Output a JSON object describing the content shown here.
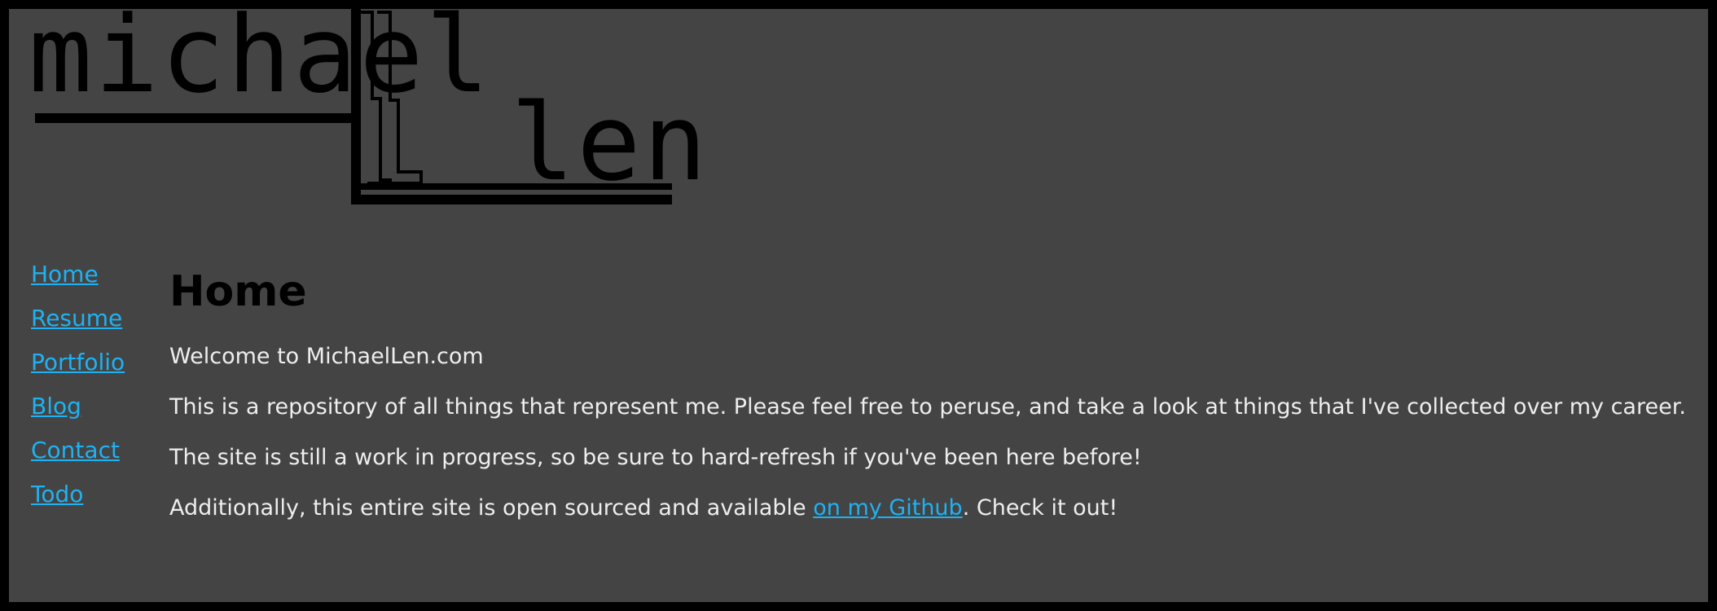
{
  "logo": {
    "first_word": "michael",
    "second_word": "len"
  },
  "nav": {
    "items": [
      {
        "label": "Home"
      },
      {
        "label": "Resume"
      },
      {
        "label": "Portfolio"
      },
      {
        "label": "Blog"
      },
      {
        "label": "Contact"
      },
      {
        "label": "Todo"
      }
    ]
  },
  "main": {
    "title": "Home",
    "paragraphs": [
      "Welcome to MichaelLen.com",
      "This is a repository of all things that represent me. Please feel free to peruse, and take a look at things that I've collected over my career.",
      "The site is still a work in progress, so be sure to hard-refresh if you've been here before!"
    ],
    "last_paragraph": {
      "before_link": "Additionally, this entire site is open sourced and available ",
      "link_text": "on my Github",
      "after_link": ". Check it out!"
    }
  },
  "colors": {
    "page_border": "#000000",
    "background": "#444444",
    "link": "#1fb2f2",
    "text": "#eeeeee",
    "heading": "#000000"
  }
}
